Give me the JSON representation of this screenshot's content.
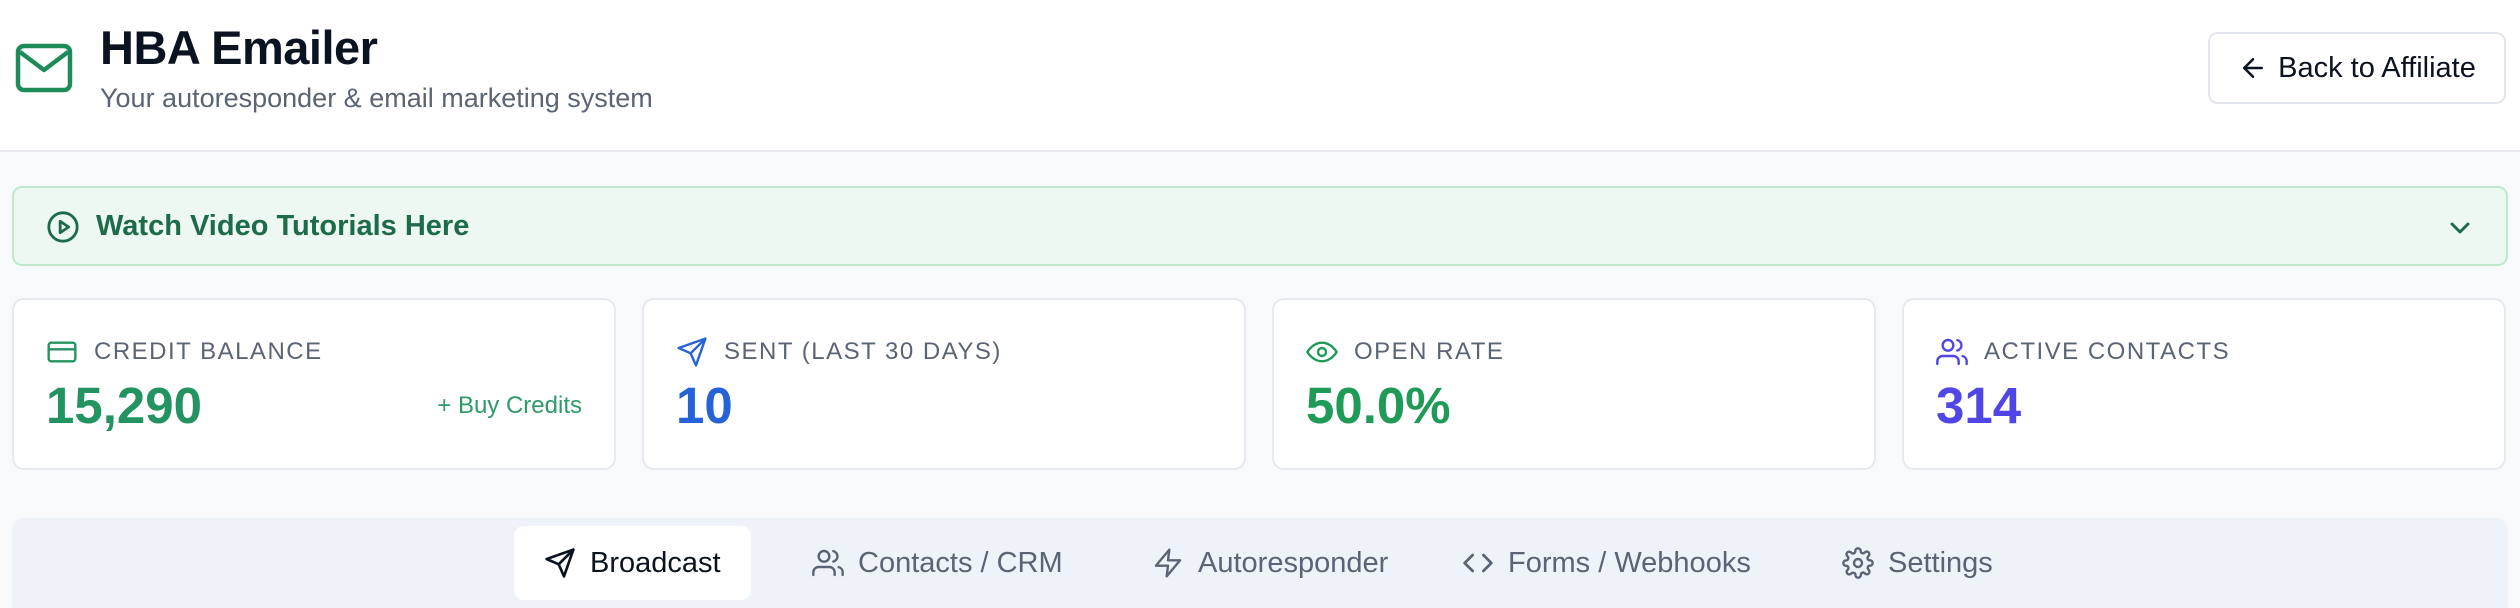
{
  "header": {
    "title": "HBA Emailer",
    "subtitle": "Your autoresponder & email marketing system",
    "back_label": "Back to Affiliate",
    "logo_icon": "mail-icon"
  },
  "tutorials": {
    "label": "Watch Video Tutorials Here"
  },
  "stats": [
    {
      "label": "CREDIT BALANCE",
      "value": "15,290",
      "icon": "credit-card-icon",
      "color": "#239461",
      "action": "+ Buy Credits"
    },
    {
      "label": "SENT (LAST 30 DAYS)",
      "value": "10",
      "icon": "send-icon",
      "color": "#2563d6"
    },
    {
      "label": "OPEN RATE",
      "value": "50.0%",
      "icon": "eye-icon",
      "color": "#1f9a57"
    },
    {
      "label": "ACTIVE CONTACTS",
      "value": "314",
      "icon": "users-icon",
      "color": "#4f46e5"
    }
  ],
  "tabs": [
    {
      "label": "Broadcast",
      "icon": "send-icon",
      "active": true
    },
    {
      "label": "Contacts / CRM",
      "icon": "users-icon"
    },
    {
      "label": "Autoresponder",
      "icon": "zap-icon"
    },
    {
      "label": "Forms / Webhooks",
      "icon": "code-icon"
    },
    {
      "label": "Settings",
      "icon": "gear-icon"
    }
  ],
  "colors": {
    "brand": "#1f8a5a",
    "accent_green": "#239461",
    "accent_blue": "#2563d6",
    "accent_purple": "#4f46e5"
  }
}
